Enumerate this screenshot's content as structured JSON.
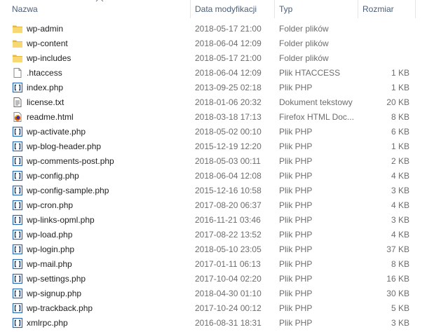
{
  "columns": {
    "name": "Nazwa",
    "date": "Data modyfikacji",
    "type": "Typ",
    "size": "Rozmiar"
  },
  "sort": {
    "column": "name",
    "direction": "ascending",
    "icon": "chevron-up-icon"
  },
  "colors": {
    "folder": "#f8d775",
    "php_icon_blue": "#2b6cb0",
    "header_text": "#4c607a",
    "meta_text": "#6d6d6d"
  },
  "files": [
    {
      "name": "wp-admin",
      "date": "2018-05-17 21:00",
      "type": "Folder plików",
      "size": "",
      "icon": "folder-icon"
    },
    {
      "name": "wp-content",
      "date": "2018-06-04 12:09",
      "type": "Folder plików",
      "size": "",
      "icon": "folder-icon"
    },
    {
      "name": "wp-includes",
      "date": "2018-05-17 21:00",
      "type": "Folder plików",
      "size": "",
      "icon": "folder-icon"
    },
    {
      "name": ".htaccess",
      "date": "2018-06-04 12:09",
      "type": "Plik HTACCESS",
      "size": "1 KB",
      "icon": "blank-file-icon"
    },
    {
      "name": "index.php",
      "date": "2013-09-25 02:18",
      "type": "Plik PHP",
      "size": "1 KB",
      "icon": "php-file-icon"
    },
    {
      "name": "license.txt",
      "date": "2018-01-06 20:32",
      "type": "Dokument tekstowy",
      "size": "20 KB",
      "icon": "text-file-icon"
    },
    {
      "name": "readme.html",
      "date": "2018-03-18 17:13",
      "type": "Firefox HTML Doc...",
      "size": "8 KB",
      "icon": "firefox-html-icon"
    },
    {
      "name": "wp-activate.php",
      "date": "2018-05-02 00:10",
      "type": "Plik PHP",
      "size": "6 KB",
      "icon": "php-file-icon"
    },
    {
      "name": "wp-blog-header.php",
      "date": "2015-12-19 12:20",
      "type": "Plik PHP",
      "size": "1 KB",
      "icon": "php-file-icon"
    },
    {
      "name": "wp-comments-post.php",
      "date": "2018-05-03 00:11",
      "type": "Plik PHP",
      "size": "2 KB",
      "icon": "php-file-icon"
    },
    {
      "name": "wp-config.php",
      "date": "2018-06-04 12:08",
      "type": "Plik PHP",
      "size": "4 KB",
      "icon": "php-file-icon"
    },
    {
      "name": "wp-config-sample.php",
      "date": "2015-12-16 10:58",
      "type": "Plik PHP",
      "size": "3 KB",
      "icon": "php-file-icon"
    },
    {
      "name": "wp-cron.php",
      "date": "2017-08-20 06:37",
      "type": "Plik PHP",
      "size": "4 KB",
      "icon": "php-file-icon"
    },
    {
      "name": "wp-links-opml.php",
      "date": "2016-11-21 03:46",
      "type": "Plik PHP",
      "size": "3 KB",
      "icon": "php-file-icon"
    },
    {
      "name": "wp-load.php",
      "date": "2017-08-22 13:52",
      "type": "Plik PHP",
      "size": "4 KB",
      "icon": "php-file-icon"
    },
    {
      "name": "wp-login.php",
      "date": "2018-05-10 23:05",
      "type": "Plik PHP",
      "size": "37 KB",
      "icon": "php-file-icon"
    },
    {
      "name": "wp-mail.php",
      "date": "2017-01-11 06:13",
      "type": "Plik PHP",
      "size": "8 KB",
      "icon": "php-file-icon"
    },
    {
      "name": "wp-settings.php",
      "date": "2017-10-04 02:20",
      "type": "Plik PHP",
      "size": "16 KB",
      "icon": "php-file-icon"
    },
    {
      "name": "wp-signup.php",
      "date": "2018-04-30 01:10",
      "type": "Plik PHP",
      "size": "30 KB",
      "icon": "php-file-icon"
    },
    {
      "name": "wp-trackback.php",
      "date": "2017-10-24 00:12",
      "type": "Plik PHP",
      "size": "5 KB",
      "icon": "php-file-icon"
    },
    {
      "name": "xmlrpc.php",
      "date": "2016-08-31 18:31",
      "type": "Plik PHP",
      "size": "3 KB",
      "icon": "php-file-icon"
    }
  ]
}
